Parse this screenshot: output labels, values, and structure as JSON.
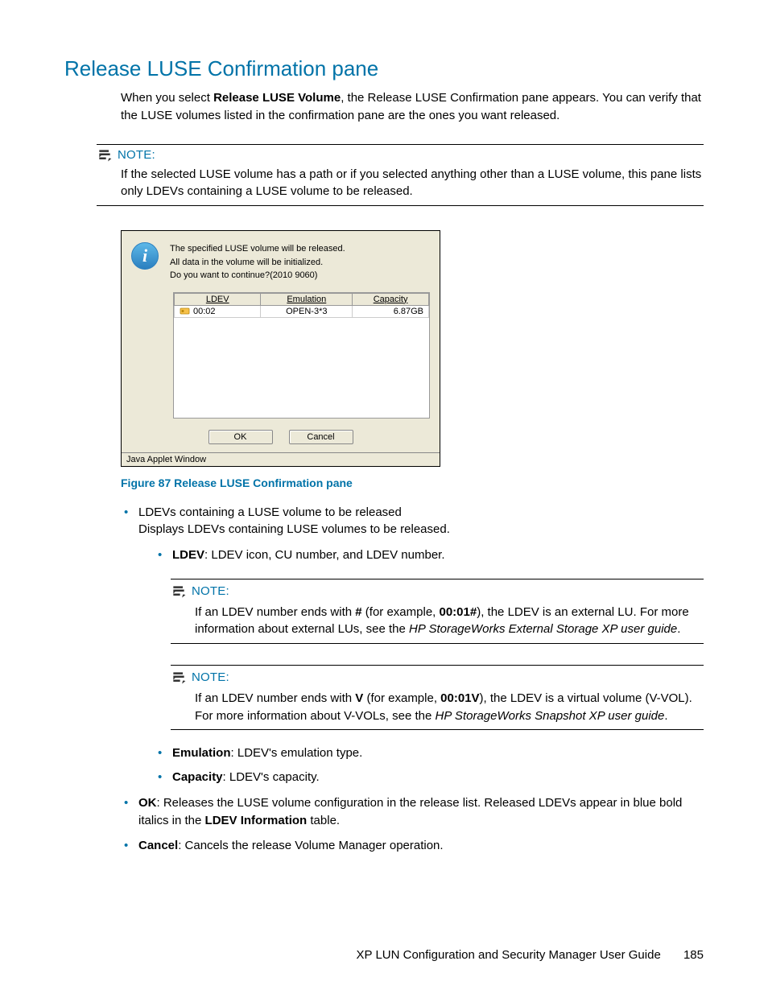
{
  "heading": "Release LUSE Confirmation pane",
  "intro_prefix": "When you select ",
  "intro_bold": "Release LUSE Volume",
  "intro_suffix": ", the Release LUSE Confirmation pane appears. You can verify that the LUSE volumes listed in the confirmation pane are the ones you want released.",
  "note_label": "NOTE:",
  "note1_body": "If the selected LUSE volume has a path or if you selected anything other than a LUSE volume, this pane lists only LDEVs containing a LUSE volume to be released.",
  "applet": {
    "msg_line1": "The specified LUSE volume will be released.",
    "msg_line2": "All data in the volume will be initialized.",
    "msg_line3": "Do you want to continue?(2010 9060)",
    "col_ldev": "LDEV",
    "col_emu": "Emulation",
    "col_cap": "Capacity",
    "row_ldev": "00:02",
    "row_emu": "OPEN-3*3",
    "row_cap": "6.87GB",
    "ok": "OK",
    "cancel": "Cancel",
    "status": "Java Applet Window"
  },
  "caption": "Figure 87 Release LUSE Confirmation pane",
  "b1_line1": "LDEVs containing a LUSE volume to be released",
  "b1_line2": "Displays LDEVs containing LUSE volumes to be released.",
  "b1_1_label": "LDEV",
  "b1_1_rest": ": LDEV icon, CU number, and LDEV number.",
  "note2_p1": "If an LDEV number ends with ",
  "note2_b1": "#",
  "note2_p2": " (for example, ",
  "note2_b2": "00:01#",
  "note2_p3": "), the LDEV is an external LU. For more information about external LUs, see the ",
  "note2_i": "HP StorageWorks External Storage XP user guide",
  "note2_p4": ".",
  "note3_p1": "If an LDEV number ends with ",
  "note3_b1": "V",
  "note3_p2": " (for example, ",
  "note3_b2": "00:01V",
  "note3_p3": "), the LDEV is a virtual volume (V-VOL). For more information about V-VOLs, see the ",
  "note3_i": "HP StorageWorks Snapshot XP user guide",
  "note3_p4": ".",
  "b1_2_label": "Emulation",
  "b1_2_rest": ": LDEV's emulation type.",
  "b1_3_label": "Capacity",
  "b1_3_rest": ": LDEV's capacity.",
  "b2_label": "OK",
  "b2_p1": ": Releases the LUSE volume configuration in the release list. Released LDEVs appear in blue bold italics in the ",
  "b2_b2": "LDEV Information",
  "b2_p2": " table.",
  "b3_label": "Cancel",
  "b3_rest": ": Cancels the release Volume Manager operation.",
  "footer_title": "XP LUN Configuration and Security Manager User Guide",
  "footer_page": "185"
}
